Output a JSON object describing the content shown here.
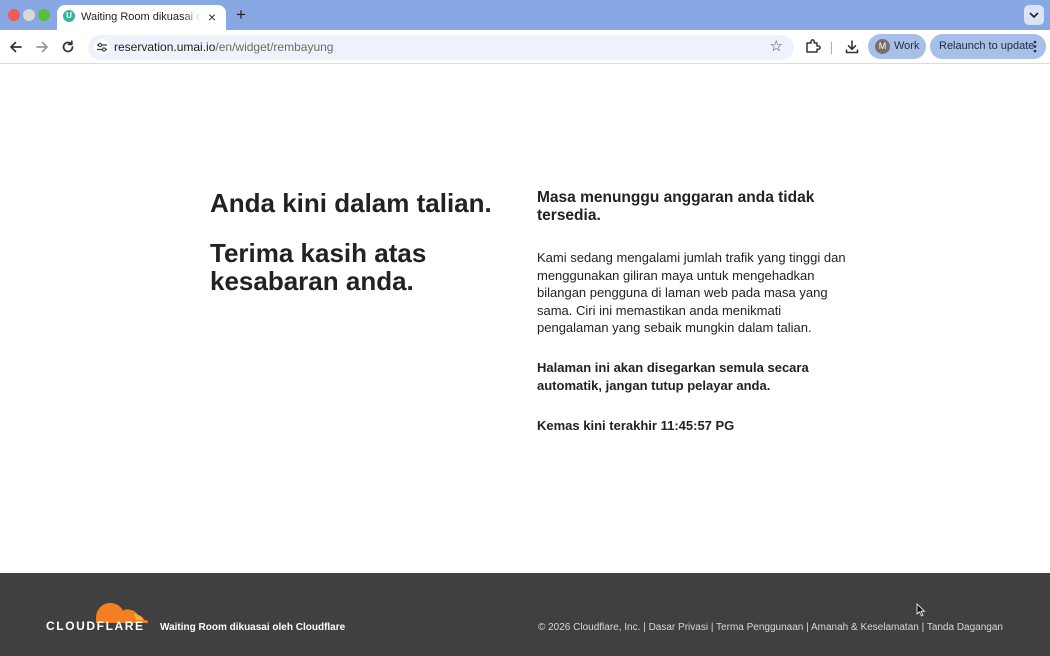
{
  "browser": {
    "tab_title": "Waiting Room dikuasai oleh Cloudflare",
    "tab_favicon_letter": "U",
    "url_host": "reservation.umai.io",
    "url_path": "/en/widget/rembayung",
    "profile_initial": "M",
    "profile_label": "Work",
    "relaunch_label": "Relaunch to update"
  },
  "main": {
    "heading_online": "Anda kini dalam talian.",
    "heading_thanks": "Terima kasih atas kesabaran anda.",
    "heading_wait": "Masa menunggu anggaran anda tidak tersedia.",
    "body": "Kami sedang mengalami jumlah trafik yang tinggi dan menggunakan giliran maya untuk mengehadkan bilangan pengguna di laman web pada masa yang sama. Ciri ini memastikan anda menikmati pengalaman yang sebaik mungkin dalam talian.",
    "refresh_note": "Halaman ini akan disegarkan semula secara automatik, jangan tutup pelayar anda.",
    "last_update_label": "Kemas kini terakhir",
    "last_update_time": "11:45:57 PG"
  },
  "footer": {
    "wordmark": "CLOUDFLARE",
    "powered_by": "Waiting Room dikuasai oleh Cloudflare",
    "copyright": "© 2026 Cloudflare, Inc.",
    "links": [
      "Dasar Privasi",
      "Terma Penggunaan",
      "Amanah & Keselamatan",
      "Tanda Dagangan"
    ],
    "separator": "|"
  },
  "colors": {
    "tabbar": "#88a8e3",
    "footer_bg": "#404041",
    "cloudflare_orange": "#f38020"
  },
  "icons": [
    "back-arrow-icon",
    "forward-arrow-icon",
    "reload-icon",
    "site-settings-icon",
    "star-icon",
    "extensions-icon",
    "download-icon",
    "kebab-menu-icon",
    "close-icon",
    "plus-icon",
    "chevron-down-icon",
    "cloudflare-cloud-logo"
  ]
}
